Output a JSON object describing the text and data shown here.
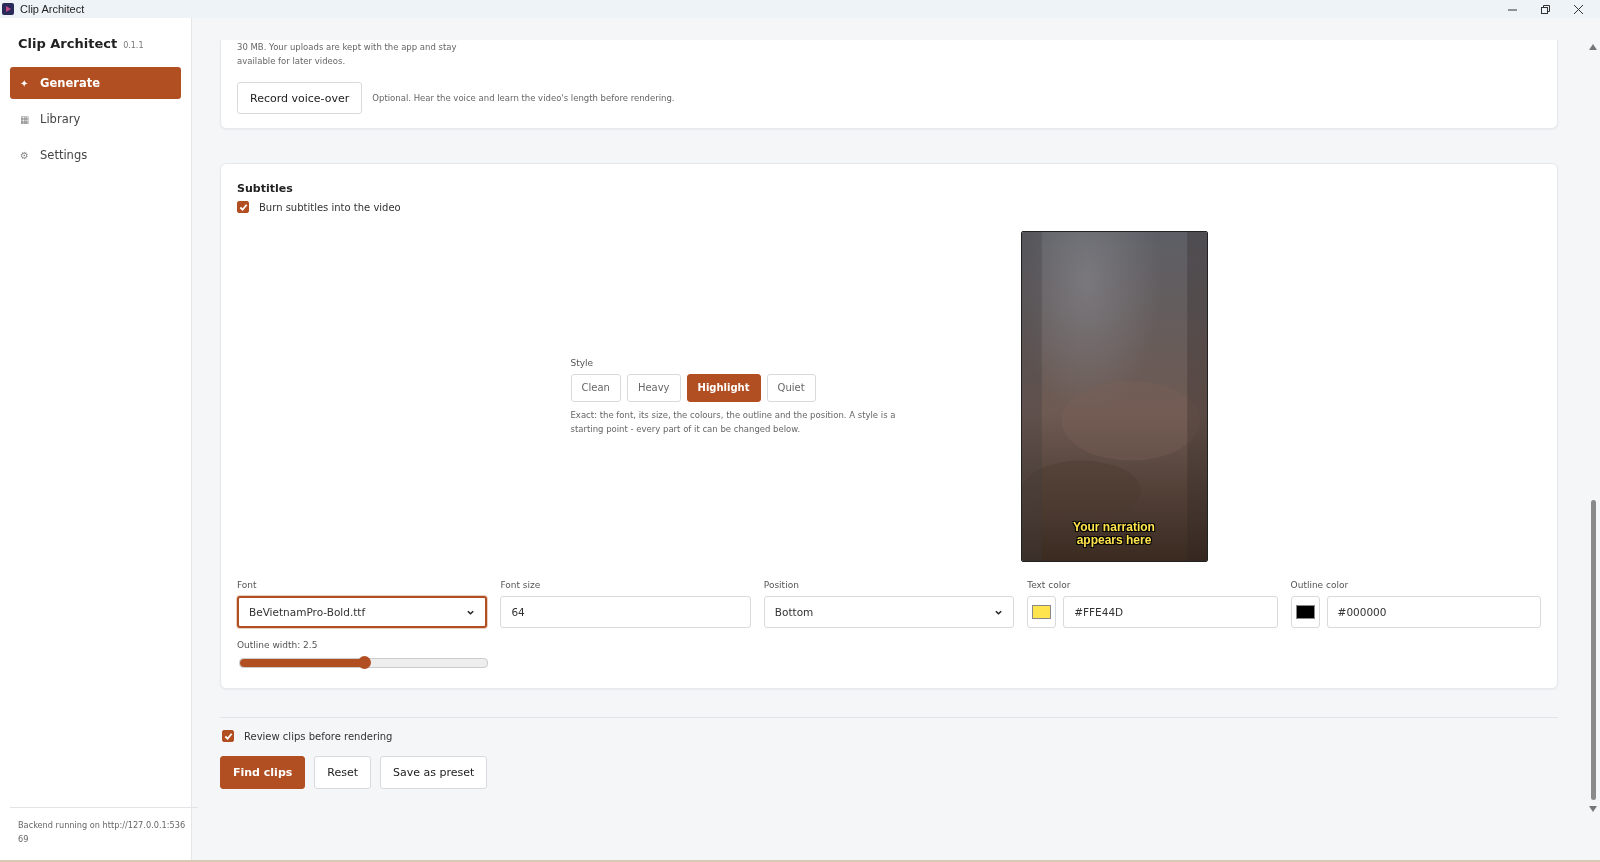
{
  "window": {
    "title": "Clip Architect"
  },
  "sidebar": {
    "app_name": "Clip Architect",
    "version": "0.1.1",
    "items": [
      {
        "label": "Generate",
        "icon": "✦",
        "selected": true
      },
      {
        "label": "Library",
        "icon": "▦",
        "selected": false
      },
      {
        "label": "Settings",
        "icon": "⚙",
        "selected": false
      }
    ],
    "footer": "Backend running on http://127.0.0.1:53669"
  },
  "upload_card": {
    "note_lines": [
      "30 MB. Your uploads are kept with the app and stay",
      "available for later videos."
    ],
    "button": "Record voice-over",
    "hint": "Optional. Hear the voice and learn the video's length before rendering."
  },
  "subtitles": {
    "title": "Subtitles",
    "burn": {
      "label": "Burn subtitles into the video",
      "checked": true
    },
    "style": {
      "label": "Style",
      "options": [
        {
          "label": "Clean",
          "selected": false
        },
        {
          "label": "Heavy",
          "selected": false
        },
        {
          "label": "Highlight",
          "selected": true
        },
        {
          "label": "Quiet",
          "selected": false
        }
      ],
      "help": "Exact: the font, its size, the colours, the outline and the position. A style is a starting point - every part of it can be changed below."
    },
    "preview": {
      "kind": "picture",
      "caption": "Your narration appears here"
    },
    "font": {
      "label": "Font",
      "value": "BeVietnamPro-Bold.ttf",
      "focused": true
    },
    "font_size": {
      "label": "Font size",
      "value": "64"
    },
    "position": {
      "label": "Position",
      "value": "Bottom"
    },
    "text_color": {
      "label": "Text color",
      "value": "#FFE44D",
      "color": "#ffe44d"
    },
    "outline_color": {
      "label": "Outline color",
      "value": "#000000",
      "color": "#000000"
    },
    "outline_width": {
      "label": "Outline width: 2.5",
      "level": 0.5
    }
  },
  "review": {
    "label": "Review clips before rendering",
    "checked": true
  },
  "actions": [
    {
      "label": "Find clips",
      "kind": "primary"
    },
    {
      "label": "Reset",
      "kind": "secondary"
    },
    {
      "label": "Save as preset",
      "kind": "secondary"
    }
  ]
}
